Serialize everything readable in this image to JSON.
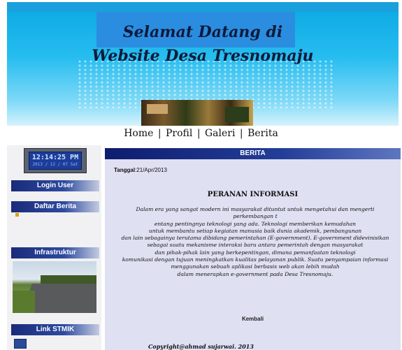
{
  "header": {
    "title_line1": "Selamat Datang di",
    "title_line2": "Website Desa Tresnomaju"
  },
  "nav": {
    "items": [
      {
        "label": "Home"
      },
      {
        "label": "Profil"
      },
      {
        "label": "Galeri"
      },
      {
        "label": "Berita"
      }
    ],
    "separator": "|"
  },
  "sidebar": {
    "clock": {
      "time": "12:14:25 PM",
      "date": "2013 / 12 / 07 Sat"
    },
    "login_label": "Login User",
    "daftar_berita_label": "Daftar Berita",
    "infrastruktur_label": "Infrastruktur",
    "link_stmik_label": "Link STMIK"
  },
  "main": {
    "header_label": "BERITA",
    "date_label": "Tanggal",
    "date_value": ":21/Apr/2013",
    "article_title": "PERANAN INFORMASI",
    "article_lines": [
      "Dalam era yang sangat modern ini masyarakat dituntut untuk mengetahui dan mengerti perkembangan t",
      "entang pentingnya teknologi yang ada. Teknologi memberikan kemudahan",
      "untuk membantu setiap kegiatan manusia baik dunia akademik, pembangunan",
      "dan lain sebagainya terutama dibidang pemerintahan (E-government). E-government didevinisikan",
      "sebagai suatu mekanisme interaksi baru antara pemerintah dengan masyarakat",
      "dan pihak-pihak lain yang berkepentingan, dimana pemanfaatan teknologi",
      "komunikasi dengan tujuan meningkatkan kualitas pelayanan publik. Suatu penyampaian informasi",
      "menggunakan sebuah aplikasi berbasis web akan lebih mudah",
      "dalam menerapkan e-government pada Desa Tresnomaju."
    ],
    "back_label": "Kembali"
  },
  "footer": {
    "text": "Copyright@ahmad sujarwai. 2013"
  }
}
